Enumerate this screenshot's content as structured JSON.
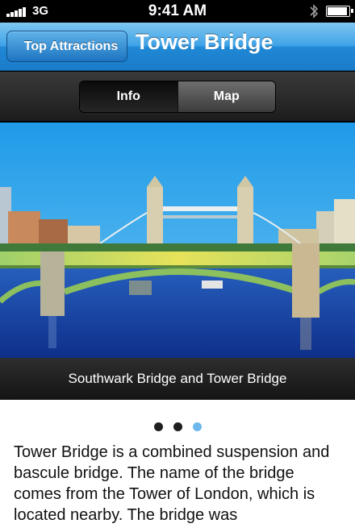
{
  "status_bar": {
    "carrier": "3G",
    "time": "9:41 AM",
    "icons": [
      "signal-bars-icon",
      "bluetooth-icon",
      "battery-icon"
    ]
  },
  "nav": {
    "back_label": "Top Attractions",
    "title": "Tower Bridge"
  },
  "segments": {
    "items": [
      "Info",
      "Map"
    ],
    "selected": "Info"
  },
  "photo": {
    "caption": "Southwark Bridge and Tower Bridge"
  },
  "pager": {
    "page_count": 3,
    "current_page": 3
  },
  "description": "Tower Bridge is a combined suspension and bascule bridge. The name of the bridge comes from the Tower of London, which is located nearby. The bridge was",
  "colors": {
    "nav_blue": "#2088d6",
    "active_dot": "#6bb8ec",
    "dark_bar": "#1c1c1c"
  }
}
